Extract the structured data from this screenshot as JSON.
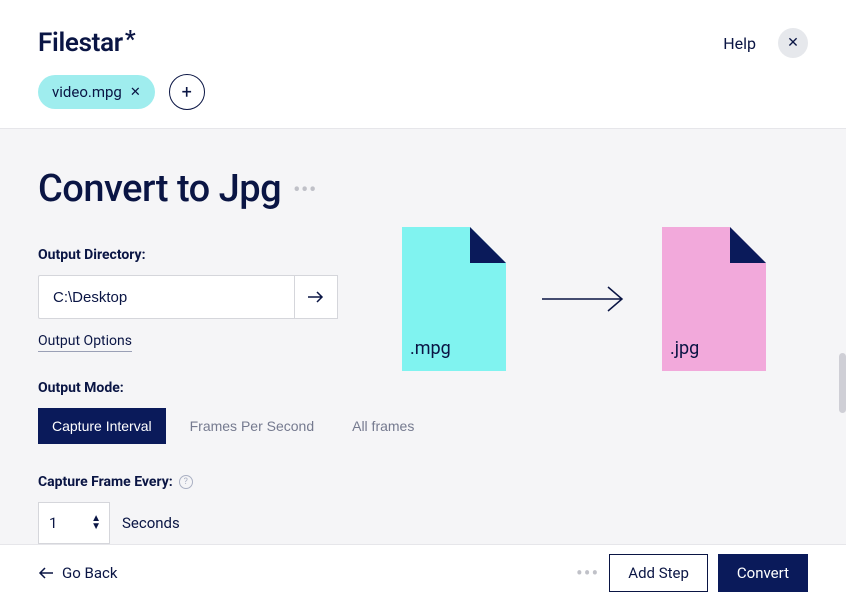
{
  "header": {
    "logo_text": "Filestar",
    "logo_star": "*",
    "help_label": "Help"
  },
  "files": {
    "chip_name": "video.mpg"
  },
  "page": {
    "title": "Convert to Jpg"
  },
  "output_dir": {
    "label": "Output Directory:",
    "value": "C:\\Desktop",
    "options_link": "Output Options"
  },
  "output_mode": {
    "label": "Output Mode:",
    "options": [
      "Capture Interval",
      "Frames Per Second",
      "All frames"
    ],
    "active_index": 0
  },
  "capture": {
    "label": "Capture Frame Every:",
    "value": "1",
    "unit": "Seconds"
  },
  "illustration": {
    "from_ext": ".mpg",
    "to_ext": ".jpg"
  },
  "footer": {
    "go_back": "Go Back",
    "add_step": "Add Step",
    "convert": "Convert"
  }
}
